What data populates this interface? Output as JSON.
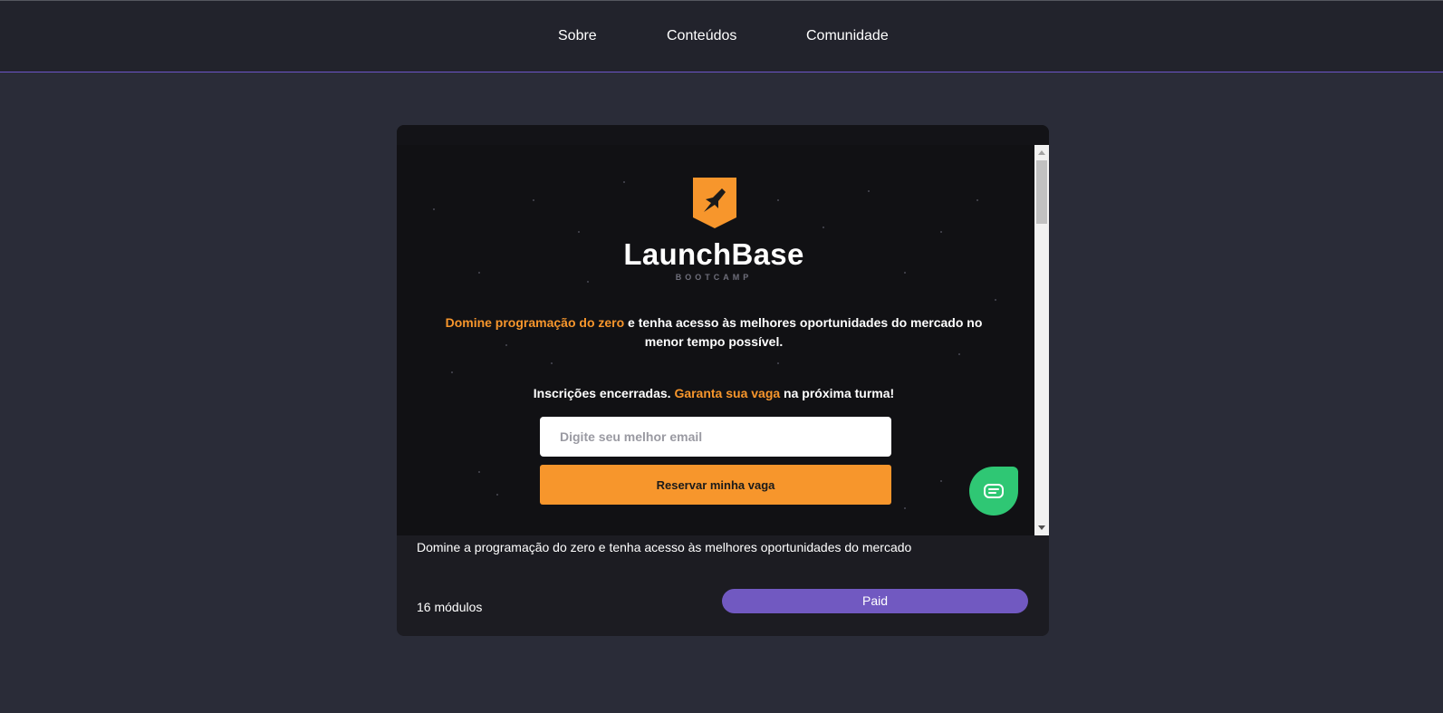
{
  "nav": {
    "items": [
      {
        "label": "Sobre"
      },
      {
        "label": "Conteúdos"
      },
      {
        "label": "Comunidade"
      }
    ]
  },
  "card": {
    "embed": {
      "brand_name": "LaunchBase",
      "brand_sub": "BOOTCAMP",
      "headline_accent": "Domine programação do zero",
      "headline_rest": " e tenha acesso às melhores oportunidades do mercado no menor tempo possível.",
      "subline_prefix": "Inscrições encerradas. ",
      "subline_accent": "Garanta sua vaga",
      "subline_suffix": " na próxima turma!",
      "email_placeholder": "Digite seu melhor email",
      "reserve_label": "Reservar minha vaga"
    },
    "description": "Domine a programação do zero e tenha acesso às melhores oportunidades do mercado",
    "modules": "16 módulos",
    "badge": "Paid"
  },
  "colors": {
    "accent_orange": "#f7962c",
    "purple": "#7159c1",
    "chat_green": "#2fc774",
    "background": "#2a2c38"
  },
  "icons": {
    "logo": "rocket-badge-icon",
    "chat": "chat-bubble-icon"
  }
}
